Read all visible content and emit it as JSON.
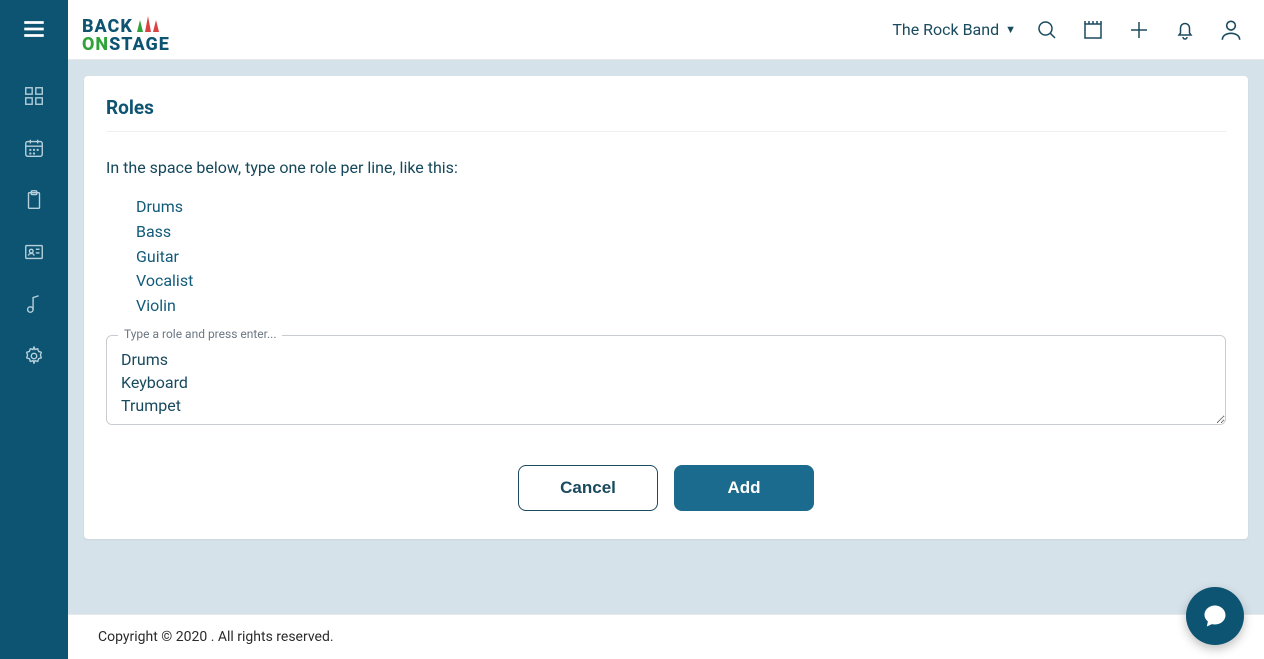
{
  "header": {
    "logo_back": "BACK",
    "logo_on": "ON",
    "logo_stage": "STAGE",
    "band_name": "The Rock Band"
  },
  "sidebar": {
    "items": [
      {
        "name": "dashboard"
      },
      {
        "name": "calendar"
      },
      {
        "name": "clipboard"
      },
      {
        "name": "contacts"
      },
      {
        "name": "music"
      },
      {
        "name": "settings"
      }
    ]
  },
  "card": {
    "title": "Roles",
    "instruction": "In the space below, type one role per line, like this:",
    "examples": [
      "Drums",
      "Bass",
      "Guitar",
      "Vocalist",
      "Violin"
    ],
    "field_label": "Type a role and press enter...",
    "input_value": "Drums\nKeyboard\nTrumpet",
    "cancel_label": "Cancel",
    "add_label": "Add"
  },
  "footer": {
    "text": "Copyright © 2020 . All rights reserved."
  }
}
